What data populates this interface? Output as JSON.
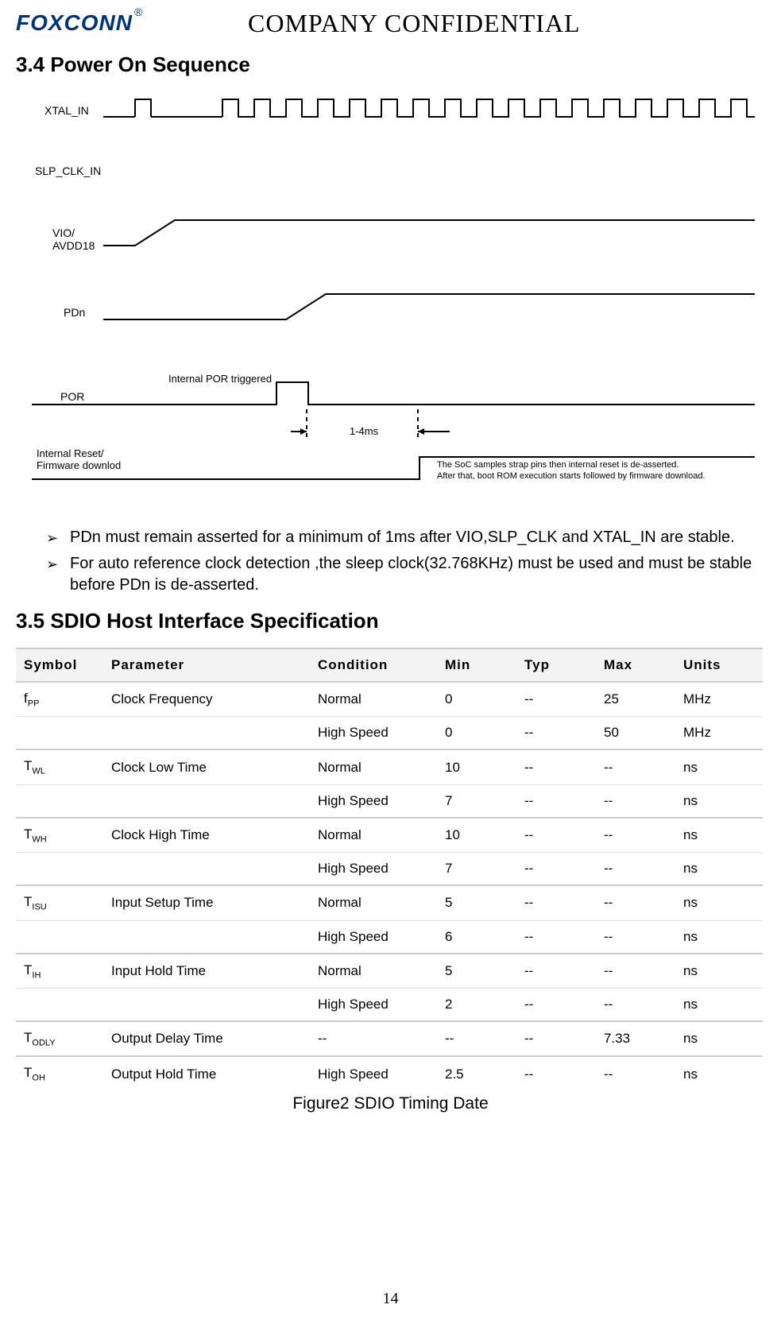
{
  "header": {
    "logo": "FOXCONN",
    "registered": "®",
    "confidential": "COMPANY  CONFIDENTIAL"
  },
  "section34": {
    "title": "3.4 Power On Sequence",
    "signals": {
      "xtal": "XTAL_IN",
      "slp": "SLP_CLK_IN",
      "vio": "VIO/\nAVDD18",
      "pdn": "PDn",
      "por": "POR",
      "reset": "Internal Reset/\nFirmware downlod"
    },
    "por_note": "Internal POR triggered",
    "delay_note": "1-4ms",
    "side_note1": "The SoC samples strap pins then internal reset is de-asserted.",
    "side_note2": "After that, boot ROM execution starts followed by firmware download.",
    "bullets": [
      "PDn must remain asserted for a minimum of 1ms after VIO,SLP_CLK and XTAL_IN are stable.",
      "For auto reference clock detection ,the sleep clock(32.768KHz) must be used and must be stable before PDn is de-asserted."
    ]
  },
  "section35": {
    "title": "3.5 SDIO Host Interface Specification",
    "columns": [
      "Symbol",
      "Parameter",
      "Condition",
      "Min",
      "Typ",
      "Max",
      "Units"
    ],
    "caption": "Figure2 SDIO Timing Date",
    "rows": [
      {
        "symbol_main": "f",
        "symbol_sub": "PP",
        "param": "Clock Frequency",
        "cond": "Normal",
        "min": "0",
        "typ": "--",
        "max": "25",
        "units": "MHz",
        "sep": true
      },
      {
        "symbol_main": "",
        "symbol_sub": "",
        "param": "",
        "cond": "High Speed",
        "min": "0",
        "typ": "--",
        "max": "50",
        "units": "MHz",
        "sep": false
      },
      {
        "symbol_main": "T",
        "symbol_sub": "WL",
        "param": "Clock Low Time",
        "cond": "Normal",
        "min": "10",
        "typ": "--",
        "max": "--",
        "units": "ns",
        "sep": true
      },
      {
        "symbol_main": "",
        "symbol_sub": "",
        "param": "",
        "cond": "High Speed",
        "min": "7",
        "typ": "--",
        "max": "--",
        "units": "ns",
        "sep": false
      },
      {
        "symbol_main": "T",
        "symbol_sub": "WH",
        "param": "Clock High Time",
        "cond": "Normal",
        "min": "10",
        "typ": "--",
        "max": "--",
        "units": "ns",
        "sep": true
      },
      {
        "symbol_main": "",
        "symbol_sub": "",
        "param": "",
        "cond": "High Speed",
        "min": "7",
        "typ": "--",
        "max": "--",
        "units": "ns",
        "sep": false
      },
      {
        "symbol_main": "T",
        "symbol_sub": "ISU",
        "param": "Input Setup Time",
        "cond": "Normal",
        "min": "5",
        "typ": "--",
        "max": "--",
        "units": "ns",
        "sep": true
      },
      {
        "symbol_main": "",
        "symbol_sub": "",
        "param": "",
        "cond": "High Speed",
        "min": "6",
        "typ": "--",
        "max": "--",
        "units": "ns",
        "sep": false
      },
      {
        "symbol_main": "T",
        "symbol_sub": "IH",
        "param": "Input Hold Time",
        "cond": "Normal",
        "min": "5",
        "typ": "--",
        "max": "--",
        "units": "ns",
        "sep": true
      },
      {
        "symbol_main": "",
        "symbol_sub": "",
        "param": "",
        "cond": "High Speed",
        "min": "2",
        "typ": "--",
        "max": "--",
        "units": "ns",
        "sep": false
      },
      {
        "symbol_main": "T",
        "symbol_sub": "ODLY",
        "param": "Output Delay Time",
        "cond": "--",
        "min": "--",
        "typ": "--",
        "max": "7.33",
        "units": "ns",
        "sep": true
      },
      {
        "symbol_main": "T",
        "symbol_sub": "OH",
        "param": "Output Hold Time",
        "cond": "High Speed",
        "min": "2.5",
        "typ": "--",
        "max": "--",
        "units": "ns",
        "sep": true
      }
    ]
  },
  "page_number": "14"
}
